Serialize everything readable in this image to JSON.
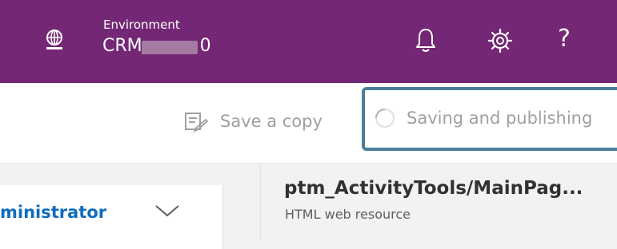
{
  "header": {
    "environment_label": "Environment",
    "environment_name": "CRM",
    "environment_name_suffix": "0",
    "help_glyph": "?",
    "icons": [
      "globe-icon",
      "bell-icon",
      "gear-icon",
      "help-icon"
    ],
    "background_color": "#742774"
  },
  "command_bar": {
    "save_copy_label": "Save a copy",
    "save_copy_icon": "save-copy-icon",
    "saving_label": "Saving and publishing",
    "spinner_icon": "spinner-icon",
    "focus_outline_color": "#4a7f99"
  },
  "left_panel": {
    "owner_text": "ministrator",
    "chevron_icon": "chevron-down-icon"
  },
  "resource": {
    "title": "ptm_ActivityTools/MainPag...",
    "type": "HTML web resource"
  }
}
